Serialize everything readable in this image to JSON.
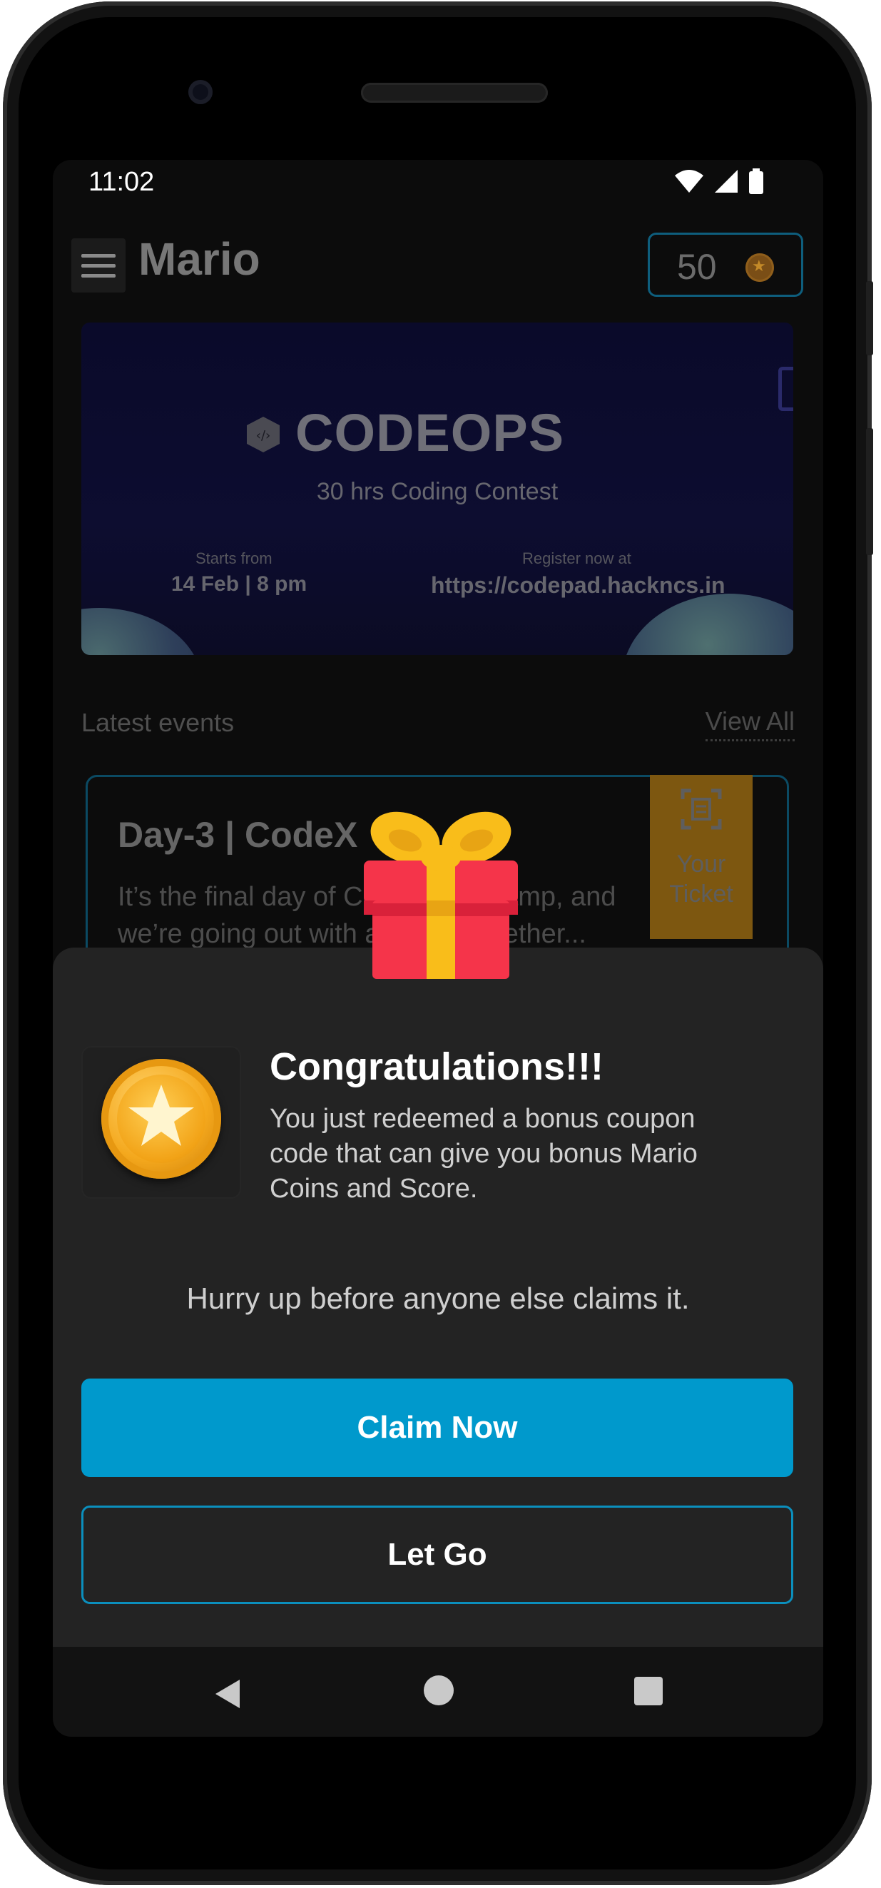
{
  "status_bar": {
    "time": "11:02"
  },
  "app_bar": {
    "title": "Mario",
    "coins": "50"
  },
  "banner": {
    "title": "CODEOPS",
    "subtitle": "30 hrs Coding Contest",
    "starts_label": "Starts from",
    "starts_value": "14 Feb |  8 pm",
    "register_label": "Register now at",
    "register_value": "https://codepad.hackncs.in"
  },
  "events": {
    "section_title": "Latest events",
    "view_all": "View All",
    "card": {
      "title": "Day-3 | CodeX",
      "description": "It’s the final day of CodeX Bootcamp, and we’re going out with a bang! Whether...",
      "ticket_label": "Your Ticket"
    }
  },
  "reward_sheet": {
    "title": "Congratulations!!!",
    "body": "You just redeemed a bonus coupon code that can give you bonus Mario Coins and Score.",
    "hint": "Hurry up before anyone else claims it.",
    "claim_button": "Claim Now",
    "letgo_button": "Let Go"
  },
  "colors": {
    "accent": "#0099cc",
    "sheet_bg": "#232323",
    "screen_bg": "#0c0c0c",
    "gift_box": "#f5344a",
    "gift_ribbon": "#f9bd1a"
  },
  "icons": [
    "menu-icon",
    "coin-icon",
    "wifi-icon",
    "signal-icon",
    "battery-icon",
    "codeops-logo-icon",
    "ticket-scan-icon",
    "gift-icon",
    "medal-star-icon",
    "nav-back-icon",
    "nav-home-icon",
    "nav-recent-icon"
  ]
}
